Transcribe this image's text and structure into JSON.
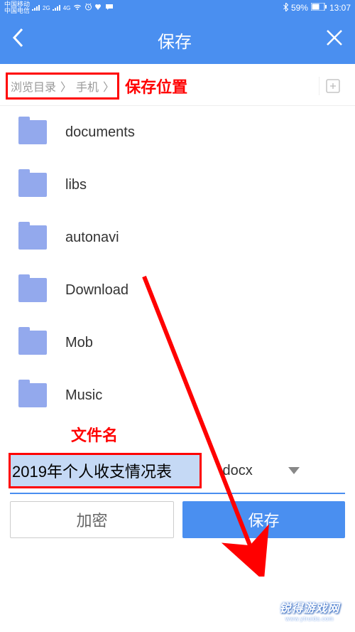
{
  "status": {
    "carrier1": "中国移动",
    "carrier2": "中国电信",
    "net_badge": "2G",
    "fourg_badge": "4G",
    "battery": "59%",
    "time": "13:07"
  },
  "nav": {
    "title": "保存"
  },
  "breadcrumb": {
    "root": "浏览目录",
    "current": "手机"
  },
  "annotations": {
    "save_location": "保存位置",
    "filename_label": "文件名"
  },
  "folders": [
    {
      "name": "documents"
    },
    {
      "name": "libs"
    },
    {
      "name": "autonavi"
    },
    {
      "name": "Download"
    },
    {
      "name": "Mob"
    },
    {
      "name": "Music"
    }
  ],
  "filename": {
    "value": "2019年个人收支情况表",
    "ext": ".docx"
  },
  "buttons": {
    "encrypt": "加密",
    "save": "保存"
  },
  "watermark": {
    "title": "锐得游戏网",
    "url": "www.ytruida.com"
  }
}
